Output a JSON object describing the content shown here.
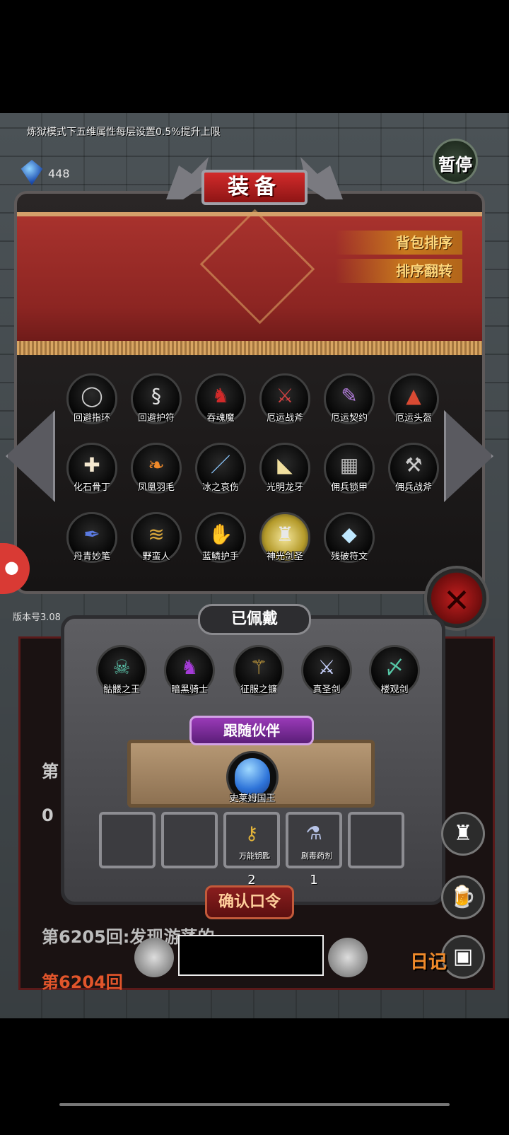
{
  "notice": "炼狱模式下五维属性每层设置0.5%提升上限",
  "currency": {
    "label": "宝石",
    "amount": "448",
    "icon": "blue-gem-icon"
  },
  "pause_label": "暂停",
  "panel": {
    "title": "装备",
    "sort_backpack": "背包排序",
    "sort_reverse": "排序翻转",
    "items": [
      {
        "name": "回避指环",
        "glyph": "◯",
        "color": "#cfcfcf"
      },
      {
        "name": "回避护符",
        "glyph": "§",
        "color": "#e0e0e0"
      },
      {
        "name": "吞魂魔",
        "glyph": "♞",
        "color": "#d22a2a"
      },
      {
        "name": "厄运战斧",
        "glyph": "⚔",
        "color": "#d24141"
      },
      {
        "name": "厄运契约",
        "glyph": "✎",
        "color": "#b67fe0"
      },
      {
        "name": "厄运头盔",
        "glyph": "▲",
        "color": "#d94a33"
      },
      {
        "name": "化石骨丁",
        "glyph": "✚",
        "color": "#f4e8d0"
      },
      {
        "name": "凤凰羽毛",
        "glyph": "❧",
        "color": "#f08a2a"
      },
      {
        "name": "冰之哀伤",
        "glyph": "／",
        "color": "#8cc8ff"
      },
      {
        "name": "光明龙牙",
        "glyph": "◣",
        "color": "#f1e0a0"
      },
      {
        "name": "佣兵锁甲",
        "glyph": "▦",
        "color": "#b5b5b5"
      },
      {
        "name": "佣兵战斧",
        "glyph": "⚒",
        "color": "#c9c9c9"
      },
      {
        "name": "丹青妙笔",
        "glyph": "✒",
        "color": "#5a7ae0"
      },
      {
        "name": "野蛮人",
        "glyph": "≋",
        "color": "#d9a63a"
      },
      {
        "name": "蓝鳞护手",
        "glyph": "✋",
        "color": "#5a4ec0"
      },
      {
        "name": "神光剑圣",
        "glyph": "♜",
        "color": "#e8e8e8"
      },
      {
        "name": "残破符文",
        "glyph": "◆",
        "color": "#bfe8ff"
      }
    ]
  },
  "version": "版本号3.08",
  "worn": {
    "title": "已佩戴",
    "items": [
      {
        "name": "骷髅之王",
        "glyph": "☠",
        "color": "#59c2a9"
      },
      {
        "name": "暗黑骑士",
        "glyph": "♞",
        "color": "#a53bd8"
      },
      {
        "name": "征服之镰",
        "glyph": "⚚",
        "color": "#e0b040"
      },
      {
        "name": "真圣剑",
        "glyph": "⚔",
        "color": "#c9d3ff"
      },
      {
        "name": "楼观剑",
        "glyph": "〆",
        "color": "#56c9a8"
      }
    ]
  },
  "follow": {
    "title": "跟随伙伴",
    "companion_name": "史莱姆国王"
  },
  "slots": [
    {
      "name": "",
      "count": "",
      "glyph": ""
    },
    {
      "name": "",
      "count": "",
      "glyph": ""
    },
    {
      "name": "万能钥匙",
      "count": "2",
      "glyph": "⚷",
      "color": "#e2b33a"
    },
    {
      "name": "剧毒药剂",
      "count": "1",
      "glyph": "⚗",
      "color": "#b8c4e8"
    },
    {
      "name": "",
      "count": "",
      "glyph": ""
    }
  ],
  "confirm_label": "确认口令",
  "log": {
    "line_a": "第 2",
    "line_b": "0",
    "line_c": "第6205回:发现游荡的",
    "line_d": "第6204回"
  },
  "diary_label": "日记"
}
